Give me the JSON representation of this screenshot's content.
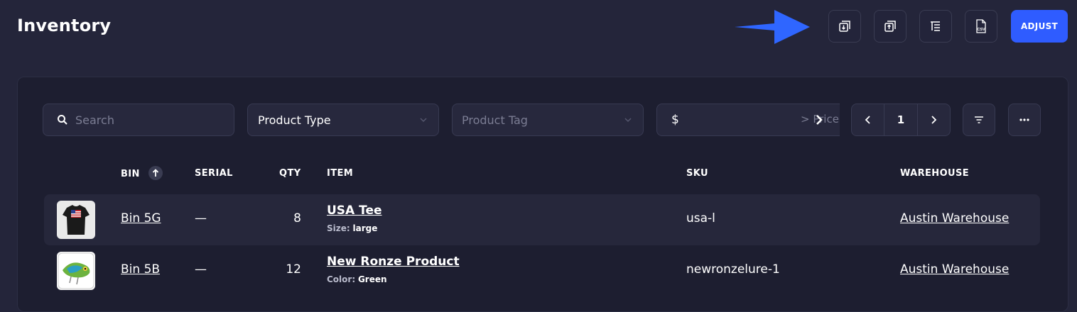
{
  "header": {
    "title": "Inventory",
    "adjust_label": "ADJUST",
    "toolbar_icons": [
      "import-icon",
      "export-icon",
      "columns-icon",
      "csv-icon"
    ],
    "csv_text": "CSV"
  },
  "filters": {
    "search_placeholder": "Search",
    "product_type": "Product Type",
    "product_tag_placeholder": "Product Tag",
    "price_prefix": "$",
    "price_placeholder": "> Price",
    "page": "1"
  },
  "table": {
    "columns": {
      "bin": "BIN",
      "serial": "SERIAL",
      "qty": "QTY",
      "item": "ITEM",
      "sku": "SKU",
      "warehouse": "WAREHOUSE"
    },
    "rows": [
      {
        "bin": "Bin 5G",
        "serial": "—",
        "qty": "8",
        "item": "USA Tee",
        "attr_label": "Size:",
        "attr_value": "large",
        "sku": "usa-l",
        "warehouse": "Austin Warehouse"
      },
      {
        "bin": "Bin 5B",
        "serial": "—",
        "qty": "12",
        "item": "New Ronze Product",
        "attr_label": "Color:",
        "attr_value": "Green",
        "sku": "newronzelure-1",
        "warehouse": "Austin Warehouse"
      }
    ]
  },
  "colors": {
    "background": "#24253a",
    "card": "#1d1e30",
    "accent": "#2f5cff",
    "arrow": "#2f66ff"
  }
}
